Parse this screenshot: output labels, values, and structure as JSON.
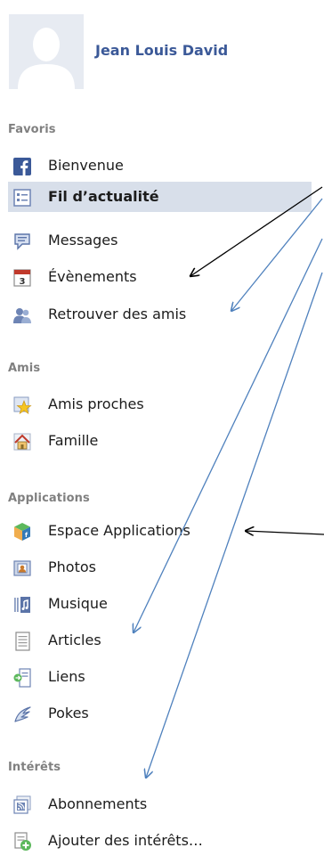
{
  "profile": {
    "name": "Jean Louis David"
  },
  "sections": {
    "favorites": {
      "title": "Favoris",
      "items": [
        {
          "label": "Bienvenue",
          "icon": "facebook-icon"
        },
        {
          "label": "Fil d’actualité",
          "icon": "news-feed-icon"
        },
        {
          "label": "Messages",
          "icon": "messages-icon"
        },
        {
          "label": "Évènements",
          "icon": "calendar-icon"
        },
        {
          "label": "Retrouver des amis",
          "icon": "find-friends-icon"
        }
      ]
    },
    "friends": {
      "title": "Amis",
      "items": [
        {
          "label": "Amis proches",
          "icon": "star-friends-icon"
        },
        {
          "label": "Famille",
          "icon": "house-icon"
        }
      ]
    },
    "applications": {
      "title": "Applications",
      "items": [
        {
          "label": "Espace Applications",
          "icon": "apps-cube-icon"
        },
        {
          "label": "Photos",
          "icon": "photos-icon"
        },
        {
          "label": "Musique",
          "icon": "music-icon"
        },
        {
          "label": "Articles",
          "icon": "notes-icon"
        },
        {
          "label": "Liens",
          "icon": "links-icon"
        },
        {
          "label": "Pokes",
          "icon": "poke-icon"
        }
      ]
    },
    "interests": {
      "title": "Intérêts",
      "items": [
        {
          "label": "Abonnements",
          "icon": "subscriptions-icon"
        },
        {
          "label": "Ajouter des intérêts…",
          "icon": "add-interests-icon"
        }
      ]
    }
  },
  "colors": {
    "brand": "#3b5998",
    "selected_bg": "#d8dfea",
    "section_gray": "#808080",
    "annotation_blue": "#4f81bd",
    "annotation_black": "#000000"
  }
}
